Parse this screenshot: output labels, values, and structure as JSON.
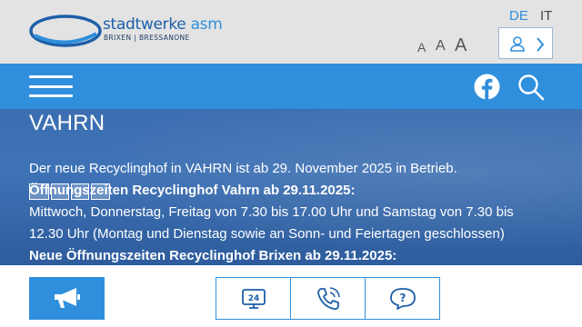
{
  "brand": {
    "name": "stadtwerke",
    "name_suffix": "asm",
    "subline": "BRIXEN | BRESSANONE"
  },
  "languages": [
    "DE",
    "IT"
  ],
  "active_language": "DE",
  "font_size_controls": [
    "A",
    "A",
    "A"
  ],
  "content": {
    "heading": "VAHRN",
    "intro": "Der neue Recyclinghof in VAHRN ist ab 29. November 2025 in Betrieb.",
    "hours_heading_1": "Öffnungszeiten Recyclinghof Vahrn ab 29.11.2025:",
    "hours_line_1": "Mittwoch, Donnerstag, Freitag von 7.30 bis 17.00 Uhr und Samstag von 7.30 bis",
    "hours_line_2": "12.30 Uhr (Montag und Dienstag sowie an Sonn- und Feiertagen geschlossen)",
    "hours_heading_2": "Neue Öffnungszeiten Recyclinghof Brixen ab 29.11.2025:"
  },
  "icons": {
    "user": "user-icon",
    "chevron": "chevron-right-icon",
    "facebook": "facebook-icon",
    "search": "search-icon",
    "menu": "menu-icon",
    "megaphone": "megaphone-icon",
    "service_24": "24h-service-icon",
    "phone": "phone-icon",
    "help": "help-icon"
  },
  "colors": {
    "brand_blue": "#2f8fdc",
    "dark_blue": "#1d5fa8",
    "header_bg": "#e3e3e3"
  }
}
